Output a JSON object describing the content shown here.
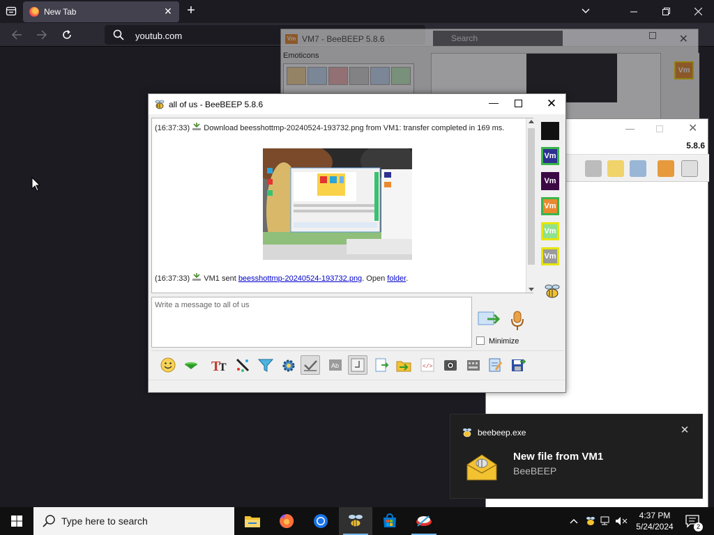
{
  "browser": {
    "tab_title": "New Tab",
    "url": "youtub.com"
  },
  "bg_window": {
    "title": "VM7 - BeeBEEP 5.8.6",
    "vm_logo_text": "Vm",
    "search_placeholder": "Search",
    "emoticons_label": "Emoticons"
  },
  "right_window": {
    "version": "5.8.6"
  },
  "chat_window": {
    "title": "all of us - BeeBEEP 5.8.6",
    "messages": [
      {
        "time": "(16:37:33)",
        "text": "Download beesshottmp-20240524-193732.png from VM1: transfer completed in 169 ms."
      },
      {
        "time": "(16:37:33)",
        "sender_text": "VM1 sent ",
        "file_link": "beesshottmp-20240524-193732.png",
        "mid_text": ". Open ",
        "folder_link": "folder",
        "end_text": "."
      }
    ],
    "compose_placeholder": "Write a message to all of us",
    "minimize_label": "Minimize",
    "users": [
      {
        "label": "",
        "bg": "#111111",
        "border": "#111111"
      },
      {
        "label": "Vm",
        "bg": "#2e3192",
        "border": "#39b54a"
      },
      {
        "label": "Vm",
        "bg": "#3b0a45",
        "border": "#3b0a45"
      },
      {
        "label": "Vm",
        "bg": "#e98a2f",
        "border": "#39b54a"
      },
      {
        "label": "Vm",
        "bg": "#8fe08f",
        "border": "#e6e600"
      },
      {
        "label": "Vm",
        "bg": "#9a9a9a",
        "border": "#e6e600"
      }
    ]
  },
  "toast": {
    "app_name": "beebeep.exe",
    "headline": "New file from VM1",
    "subtitle": "BeeBEEP"
  },
  "taskbar": {
    "search_placeholder": "Type here to search",
    "time": "4:37 PM",
    "date": "5/24/2024",
    "notification_count": "2"
  }
}
